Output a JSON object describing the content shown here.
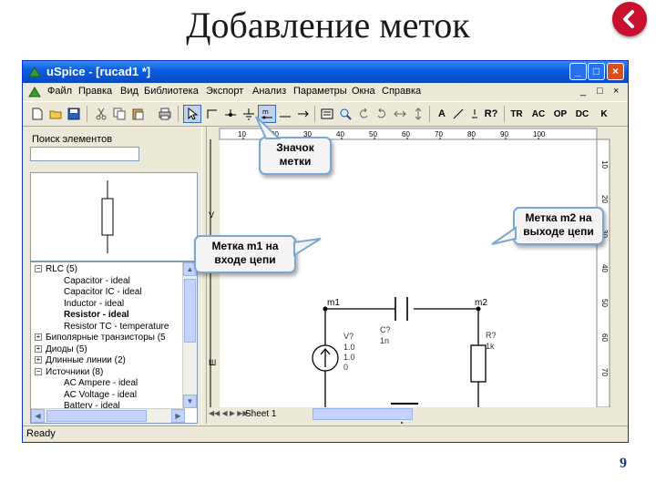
{
  "slide": {
    "title": "Добавление меток",
    "page_number": "9",
    "back_button_color": "#c8102e"
  },
  "window": {
    "title": "uSpice - [rucad1 *]",
    "title_gradient": "#0a5fe0",
    "controls": {
      "minimize": "_",
      "maximize": "□",
      "close": "×"
    }
  },
  "menubar": {
    "items": [
      "Файл",
      "Правка",
      "Вид",
      "Библиотека",
      "Экспорт",
      "Анализ",
      "Параметры",
      "Окна",
      "Справка"
    ],
    "mdi_controls": [
      "_",
      "□",
      "×"
    ]
  },
  "toolbar": {
    "text_tools": [
      "A",
      "R?",
      "TR",
      "AC",
      "OP",
      "DC",
      "K"
    ]
  },
  "left_panel": {
    "search_label": "Поиск элементов",
    "search_value": "",
    "tree": [
      {
        "label": "RLC (5)",
        "expander": "−",
        "level": 0
      },
      {
        "label": "Capacitor - ideal",
        "level": 1
      },
      {
        "label": "Capacitor IC - ideal",
        "level": 1
      },
      {
        "label": "Inductor - ideal",
        "level": 1
      },
      {
        "label": "Resistor - ideal",
        "level": 1
      },
      {
        "label": "Resistor TC - temperature",
        "level": 1
      },
      {
        "label": "Биполярные транзисторы (5",
        "expander": "+",
        "level": 0
      },
      {
        "label": "Диоды (5)",
        "expander": "+",
        "level": 0
      },
      {
        "label": "Длинные линии (2)",
        "expander": "+",
        "level": 0
      },
      {
        "label": "Источники (8)",
        "expander": "−",
        "level": 0
      },
      {
        "label": "AC Ampere - ideal",
        "level": 1
      },
      {
        "label": "AC Voltage - ideal",
        "level": 1
      },
      {
        "label": "Battery - ideal",
        "level": 1
      }
    ]
  },
  "schematic": {
    "ruler_top": [
      "10",
      "20",
      "30",
      "40",
      "50",
      "60",
      "70",
      "80",
      "90",
      "100"
    ],
    "ruler_right": [
      "10",
      "20",
      "30",
      "40",
      "50",
      "60",
      "70"
    ],
    "label_m1": "m1",
    "label_m2": "m2",
    "source": {
      "name": "V?",
      "params": [
        "1.0",
        "1.0",
        "0"
      ]
    },
    "capacitor": {
      "name": "C?",
      "value": "1n"
    },
    "resistor": {
      "name": "R?",
      "value": "1k"
    },
    "ground_label": "0",
    "sheet_tab": "Sheet 1"
  },
  "callouts": {
    "icon_callout": "Значок метки",
    "m1_callout": "Метка m1 на входе цепи",
    "m2_callout": "Метка m2 на выходе цепи",
    "callout_border": "#7aa8d2"
  },
  "status": {
    "text": "Ready"
  }
}
